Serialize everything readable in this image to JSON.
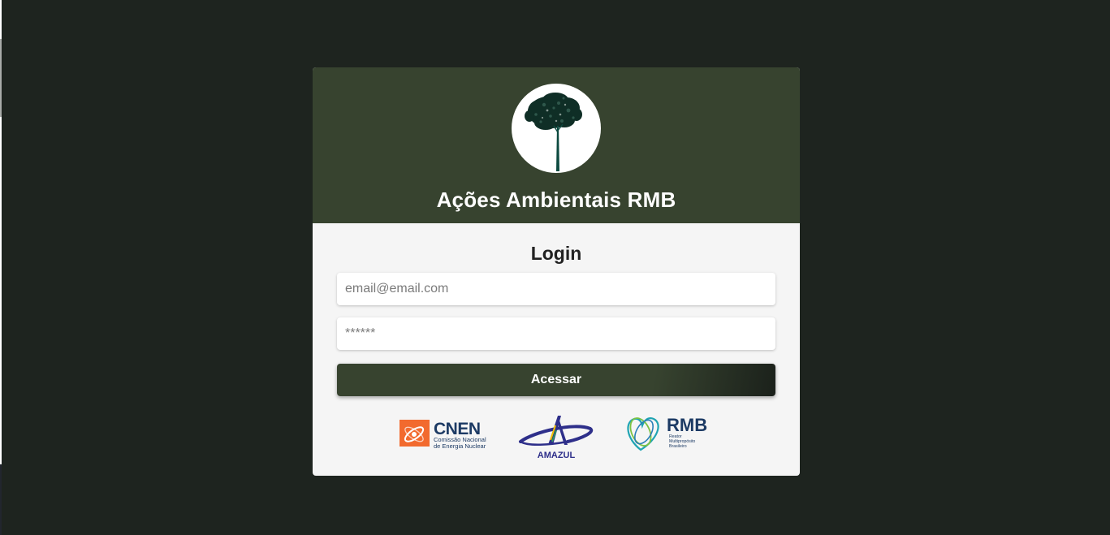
{
  "header": {
    "app_title": "Ações Ambientais RMB",
    "logo_icon": "tree-icon"
  },
  "login": {
    "title": "Login",
    "email_placeholder": "email@email.com",
    "password_placeholder": "******",
    "submit_label": "Acessar"
  },
  "partners": {
    "cnen": {
      "name": "CNEN",
      "line1": "Comissão Nacional",
      "line2": "de Energia Nuclear"
    },
    "amazul": {
      "name": "AMAZUL"
    },
    "rmb": {
      "name": "RMB",
      "line1": "Reator",
      "line2": "Multipropósito",
      "line3": "Brasileiro"
    }
  },
  "colors": {
    "page_background": "#1e241f",
    "header_background": "#37432f",
    "card_body": "#f5f5f5",
    "button_gradient_end": "#1b211b",
    "cnen_orange": "#f26a2e",
    "amazul_blue": "#2e2f8a",
    "rmb_navy": "#1c3a64"
  }
}
